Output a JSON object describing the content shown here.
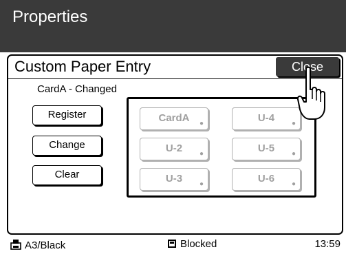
{
  "titlebar": {
    "title": "Properties"
  },
  "panel": {
    "title": "Custom Paper Entry",
    "close_label": "Close",
    "status": "CardA - Changed"
  },
  "actions": {
    "register": "Register",
    "change": "Change",
    "clear": "Clear"
  },
  "slots": [
    "CardA",
    "U-2",
    "U-3",
    "U-4",
    "U-5",
    "U-6"
  ],
  "statusbar": {
    "paper": "A3/Black",
    "block": "Blocked",
    "time": "13:59"
  },
  "colors": {
    "titlebar_bg": "#3a3a3a",
    "disabled_text": "#a0a0a0"
  }
}
